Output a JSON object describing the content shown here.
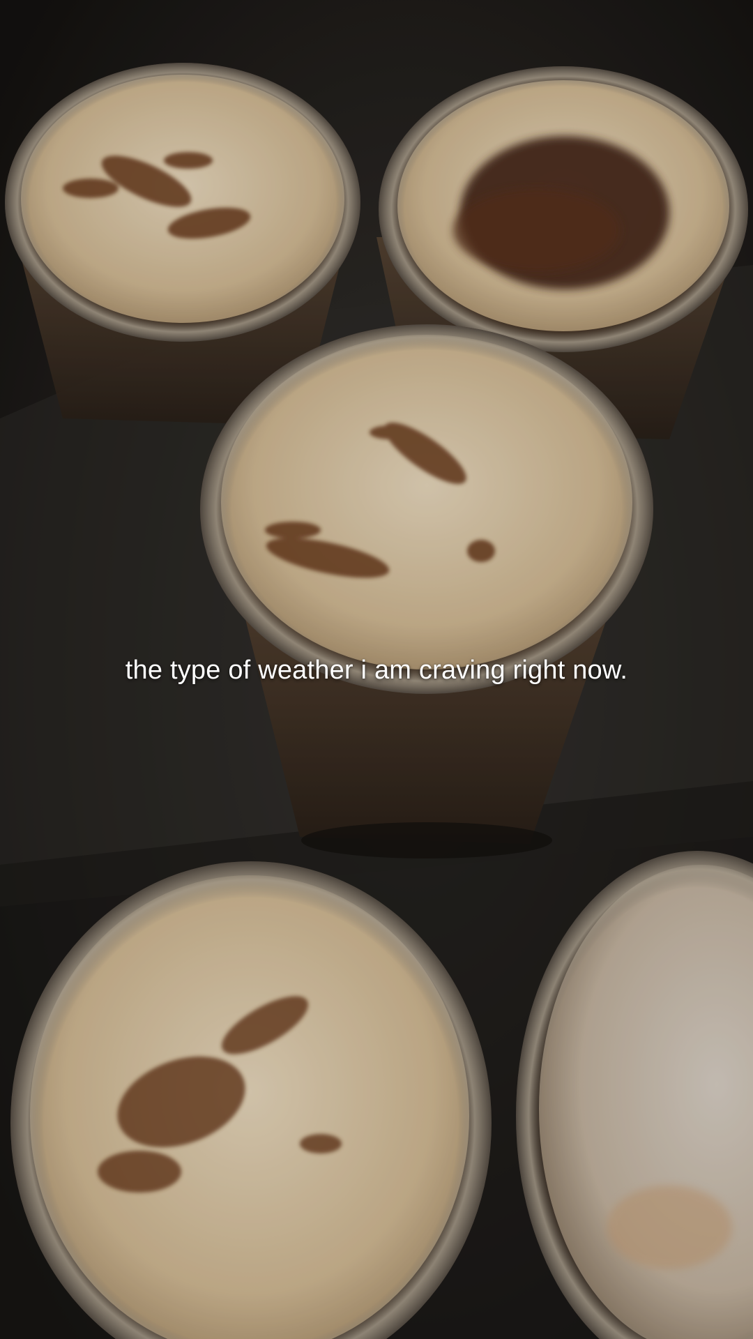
{
  "caption": "the type of weather i am craving right now.",
  "photo": {
    "subject": "cups",
    "colors": {
      "table": "#1c1a18",
      "cup_rim": "#8a8174",
      "foam": "#d8c2a2",
      "foam_light": "#e9dcc4",
      "cinnamon": "#6b3a1f",
      "cocoa": "#4a2a1a",
      "coffee_body": "#3a2a1c"
    }
  }
}
